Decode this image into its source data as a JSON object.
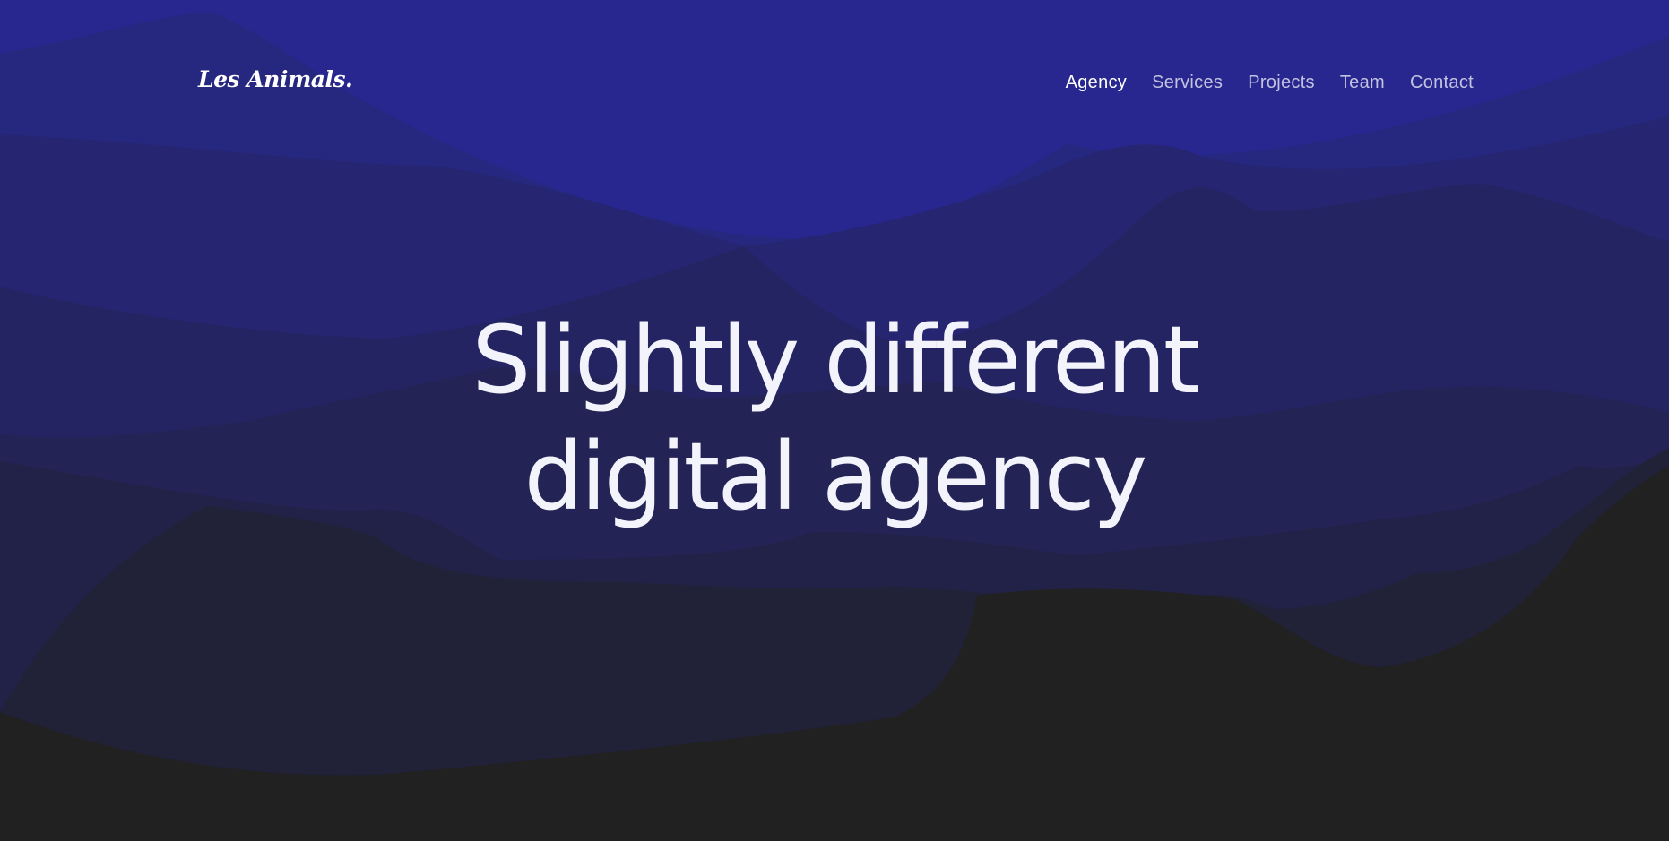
{
  "colors": {
    "sky_top": "#27278f",
    "ground": "#212121",
    "accent_text": "#ffffff"
  },
  "header": {
    "logo": "Les Animals.",
    "nav": [
      {
        "label": "Agency",
        "active": true
      },
      {
        "label": "Services",
        "active": false
      },
      {
        "label": "Projects",
        "active": false
      },
      {
        "label": "Team",
        "active": false
      },
      {
        "label": "Contact",
        "active": false
      }
    ]
  },
  "hero": {
    "line1": "Slightly different",
    "line2": "digital agency"
  }
}
